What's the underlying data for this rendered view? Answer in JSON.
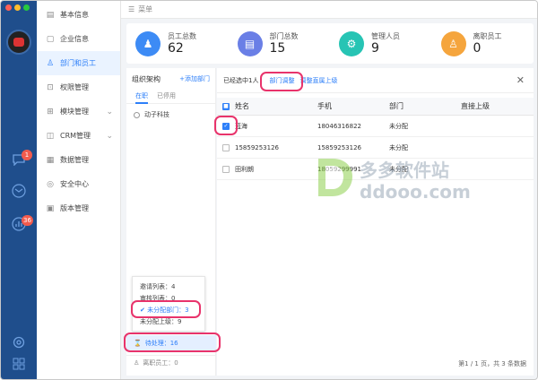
{
  "window": {
    "title_icon": "menu-icon",
    "title": "菜单"
  },
  "traffic_lights": [
    "#ff5f56",
    "#ffbd2e",
    "#27c93f"
  ],
  "rail": {
    "items": [
      {
        "icon": "chat-icon",
        "badge": "1"
      },
      {
        "icon": "mail-icon",
        "badge": ""
      },
      {
        "icon": "chart-icon",
        "badge": "36"
      }
    ],
    "bottom": [
      "settings-icon",
      "apps-icon"
    ]
  },
  "nav": {
    "items": [
      {
        "label": "基本信息",
        "icon": "info-icon",
        "active": false
      },
      {
        "label": "企业信息",
        "icon": "doc-icon",
        "active": false
      },
      {
        "label": "部门和员工",
        "icon": "user-icon",
        "active": true
      },
      {
        "label": "权限管理",
        "icon": "lock-icon",
        "active": false
      },
      {
        "label": "模块管理",
        "icon": "grid-icon",
        "active": false,
        "chevron": true
      },
      {
        "label": "CRM管理",
        "icon": "crm-icon",
        "active": false,
        "chevron": true
      },
      {
        "label": "数据管理",
        "icon": "data-icon",
        "active": false
      },
      {
        "label": "安全中心",
        "icon": "shield-icon",
        "active": false
      },
      {
        "label": "版本管理",
        "icon": "version-icon",
        "active": false
      }
    ]
  },
  "stats": [
    {
      "label": "员工总数",
      "value": "62",
      "color": "#3d8bf5"
    },
    {
      "label": "部门总数",
      "value": "15",
      "color": "#6a7fe6"
    },
    {
      "label": "管理人员",
      "value": "9",
      "color": "#27c4b4"
    },
    {
      "label": "离职员工",
      "value": "0",
      "color": "#f5a53d"
    }
  ],
  "org": {
    "title": "组织架构",
    "add_label": "+添加部门",
    "tabs": [
      "在职",
      "已停用"
    ],
    "tree_root": "动子科技",
    "popup": [
      "邀请列表：4",
      "审核列表：0",
      "未分配部门：3",
      "未分配上级：9"
    ],
    "pending": "待处理：16",
    "resigned": "离职员工：0"
  },
  "main": {
    "selected_text": "已经选中1人",
    "btn_dept": "部门调整",
    "btn_super": "调整直属上级",
    "columns": [
      "姓名",
      "手机",
      "部门",
      "直接上级"
    ],
    "rows": [
      {
        "checked": true,
        "name": "蓝海",
        "phone": "18046316822",
        "dept": "未分配",
        "superior": ""
      },
      {
        "checked": false,
        "name": "15859253126",
        "phone": "15859253126",
        "dept": "未分配",
        "superior": ""
      },
      {
        "checked": false,
        "name": "田利朗",
        "phone": "18059299991",
        "dept": "未分配",
        "superior": ""
      }
    ],
    "footer": "第1 / 1 页，共 3 条数据"
  },
  "watermark": {
    "text": "多多软件站",
    "url_text": "ddooo.com"
  }
}
